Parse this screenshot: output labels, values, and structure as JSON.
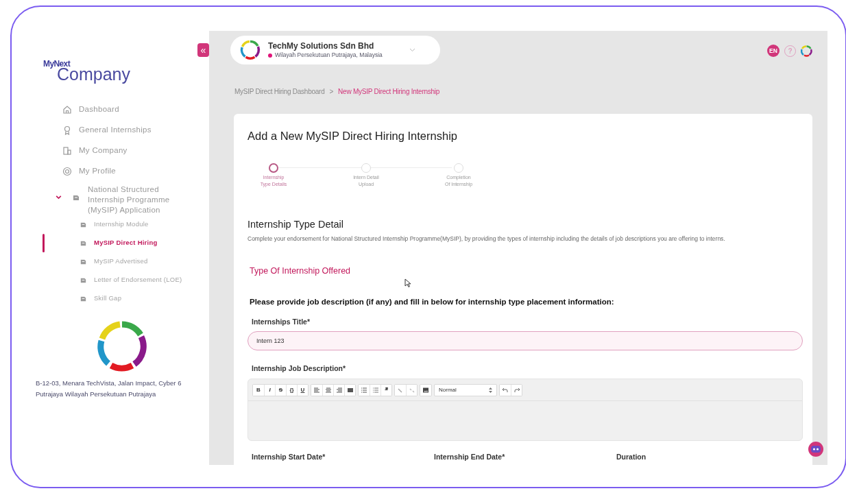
{
  "sidebar": {
    "logo_small": "MyNext",
    "logo": "Company",
    "items": [
      {
        "label": "Dashboard",
        "kind": "home",
        "selected": false
      },
      {
        "label": "General Internships",
        "kind": "award",
        "selected": false
      },
      {
        "label": "My Company",
        "kind": "building",
        "selected": false
      },
      {
        "label": "My Profile",
        "kind": "profile",
        "selected": false
      },
      {
        "label": "National Structured Internship Programme (MySIP) Application",
        "kind": "group",
        "expanded": true,
        "selected": false,
        "children": [
          {
            "label": "Internship Module",
            "selected": false
          },
          {
            "label": "MySIP Direct Hiring",
            "selected": true
          },
          {
            "label": "MySIP Advertised",
            "selected": false
          },
          {
            "label": "Letter of Endorsement (LOE)",
            "selected": false
          },
          {
            "label": "Skill Gap",
            "selected": false
          }
        ]
      }
    ],
    "address": "B-12-03, Menara TechVista, Jalan Impact, Cyber 6 Putrajaya Wilayah Persekutuan Putrajaya"
  },
  "collapse_button": "«",
  "company": {
    "name": "TechMy Solutions Sdn Bhd",
    "location": "Wilayah Persekutuan Putrajaya, Malaysia"
  },
  "header": {
    "language": "EN",
    "help": "?"
  },
  "breadcrumb": [
    {
      "label": "MySIP Direct Hiring Dashboard",
      "selected": false
    },
    {
      "label": "New MySIP Direct Hiring Internship",
      "selected": true
    }
  ],
  "breadcrumb_separator": ">",
  "card": {
    "title": "Add a New MySIP Direct Hiring Internship",
    "steps": [
      {
        "label": "Internship Type Details",
        "selected": true
      },
      {
        "label": "Intern Detail Upload",
        "selected": false
      },
      {
        "label": "Completion Of Internship",
        "selected": false
      }
    ],
    "section_title": "Internship Type Detail",
    "description": "Complete your endorsement for National Structured Internship Programme(MySIP), by providing the types of internship including the details of job descriptions you are offering to interns.",
    "subtitle": "Type Of Internship Offered",
    "instruction": "Please provide job description (if any) and fill in below for internship type placement information:",
    "title_field": {
      "label": "Internships Title*",
      "value": "Intern 123"
    },
    "description_field": {
      "label": "Internship Job Description*",
      "toolbar": [
        [
          {
            "kind": "text",
            "label": "B"
          },
          {
            "kind": "text",
            "label": "I"
          },
          {
            "kind": "text",
            "label": "S"
          },
          {
            "kind": "text",
            "label": "{}"
          },
          {
            "kind": "text",
            "label": "U"
          }
        ],
        [
          {
            "kind": "align-left"
          },
          {
            "kind": "align-center"
          },
          {
            "kind": "align-right"
          },
          {
            "kind": "justify"
          }
        ],
        [
          {
            "kind": "bullet-list"
          },
          {
            "kind": "numbered-list"
          },
          {
            "kind": "text",
            "label": "❞"
          }
        ],
        [
          {
            "kind": "link"
          },
          {
            "kind": "unlink"
          }
        ],
        [
          {
            "kind": "image"
          }
        ]
      ],
      "format_select": "Normal"
    },
    "bottom_labels": [
      "Internship Start Date*",
      "Internship End Date*",
      "Duration"
    ]
  }
}
